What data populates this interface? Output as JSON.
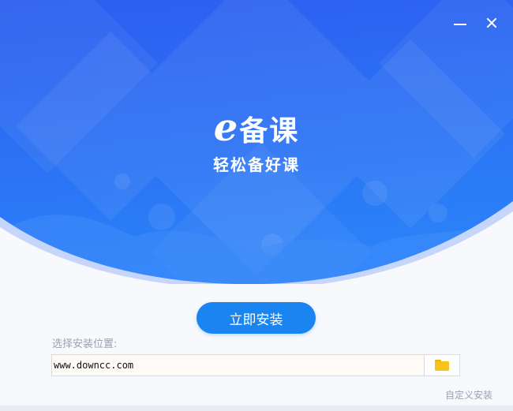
{
  "window": {
    "controls": {
      "minimize_icon": "minimize-icon",
      "close_icon": "close-icon"
    }
  },
  "hero": {
    "logo_prefix": "e",
    "logo_name": "备课",
    "slogan": "轻松备好课",
    "colors": {
      "top": "#2f63f2",
      "bottom": "#2b7ef7",
      "wave": "#b9cdfb"
    }
  },
  "install": {
    "button_label": "立即安装",
    "path_label": "选择安装位置:",
    "path_value": "www.downcc.com",
    "browse_icon": "folder-icon",
    "custom_link": "自定义安装"
  },
  "colors": {
    "accent": "#1a84f0",
    "muted": "#9aa3b1"
  }
}
